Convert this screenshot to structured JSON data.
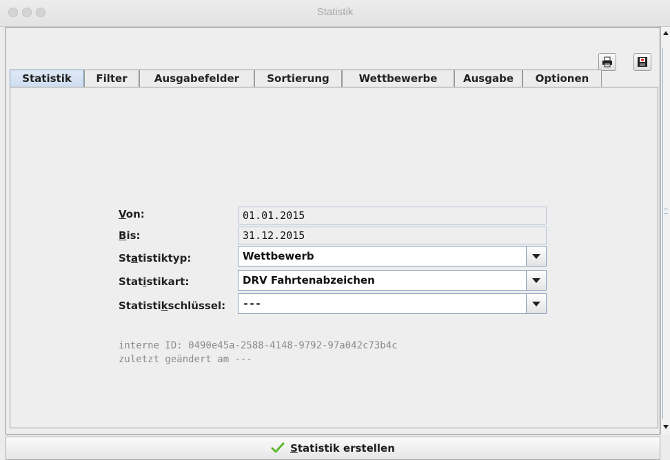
{
  "window": {
    "title": "Statistik"
  },
  "toolbar": {
    "print_icon": "printer-icon",
    "save_icon": "save-icon"
  },
  "tabs": [
    {
      "label": "Statistik",
      "active": true
    },
    {
      "label": "Filter"
    },
    {
      "label": "Ausgabefelder"
    },
    {
      "label": "Sortierung"
    },
    {
      "label": "Wettbewerbe"
    },
    {
      "label": "Ausgabe"
    },
    {
      "label": "Optionen"
    }
  ],
  "form": {
    "von": {
      "label_pre": "",
      "label_key": "V",
      "label_post": "on:",
      "value": "01.01.2015"
    },
    "bis": {
      "label_pre": "",
      "label_key": "B",
      "label_post": "is:",
      "value": "31.12.2015"
    },
    "statistiktyp": {
      "label_pre": "St",
      "label_key": "a",
      "label_post": "tistiktyp:",
      "value": "Wettbewerb"
    },
    "statistikart": {
      "label_pre": "Stat",
      "label_key": "i",
      "label_post": "stikart:",
      "value": "DRV Fahrtenabzeichen"
    },
    "statistikschluessel": {
      "label_pre": "Statisti",
      "label_key": "k",
      "label_post": "schlüssel:",
      "value": "---"
    }
  },
  "info": {
    "internal_id": "interne ID: 0490e45a-2588-4148-9792-97a042c73b4c",
    "last_changed": "zuletzt geändert am ---"
  },
  "action": {
    "label_key": "S",
    "label_rest": "tatistik erstellen",
    "icon": "checkmark-icon"
  },
  "colors": {
    "active_tab": "#ccdcf0",
    "combo_border": "#8aa1bd",
    "check": "#5cb82c"
  }
}
